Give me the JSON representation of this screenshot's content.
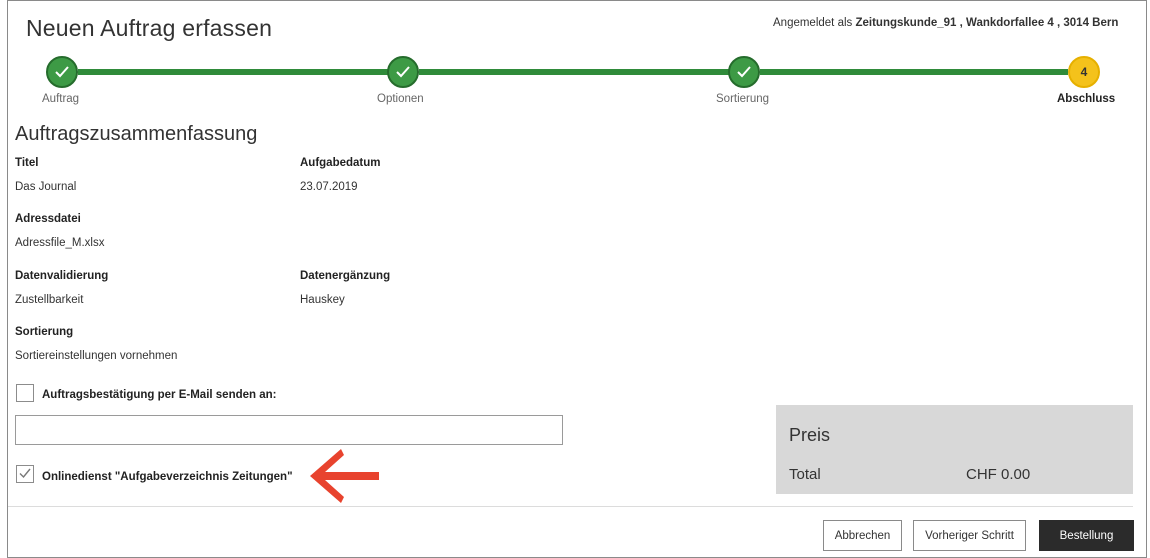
{
  "header": {
    "title": "Neuen Auftrag erfassen",
    "login_prefix": "Angemeldet als",
    "login_user": "Zeitungskunde_91 , Wankdorfallee 4 , 3014 Bern"
  },
  "stepper": {
    "steps": [
      {
        "label": "Auftrag",
        "state": "done",
        "icon": "check-icon"
      },
      {
        "label": "Optionen",
        "state": "done",
        "icon": "check-icon"
      },
      {
        "label": "Sortierung",
        "state": "done",
        "icon": "check-icon"
      },
      {
        "label": "Abschluss",
        "state": "current",
        "number": "4"
      }
    ],
    "colors": {
      "done": "#3d9a45",
      "line": "#2f8b3a",
      "current": "#f4c21b"
    }
  },
  "summary": {
    "title": "Auftragszusammenfassung",
    "titel_label": "Titel",
    "titel_value": "Das Journal",
    "aufgabedatum_label": "Aufgabedatum",
    "aufgabedatum_value": "23.07.2019",
    "adressdatei_label": "Adressdatei",
    "adressdatei_value": "Adressfile_M.xlsx",
    "datenvalidierung_label": "Datenvalidierung",
    "datenvalidierung_value": "Zustellbarkeit",
    "datenergaenzung_label": "Datenergänzung",
    "datenergaenzung_value": "Hauskey",
    "sortierung_label": "Sortierung",
    "sortierung_value": "Sortiereinstellungen vornehmen"
  },
  "email_confirmation": {
    "label": "Auftragsbestätigung per E-Mail senden an:",
    "checked": false,
    "input_value": "",
    "placeholder": ""
  },
  "online_service": {
    "label": "Onlinedienst \"Aufgabeverzeichnis Zeitungen\"",
    "checked": true
  },
  "annotation": {
    "icon": "arrow-left-icon",
    "color": "#e8432e"
  },
  "price": {
    "title": "Preis",
    "total_label": "Total",
    "total_value": "CHF 0.00"
  },
  "footer": {
    "cancel_label": "Abbrechen",
    "back_label": "Vorheriger Schritt",
    "order_label": "Bestellung"
  }
}
